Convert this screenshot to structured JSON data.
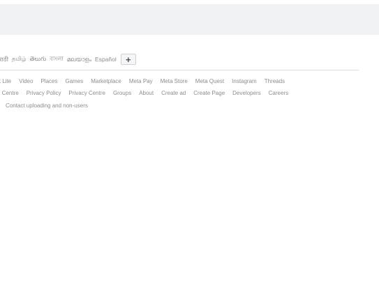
{
  "languages": [
    "मराठी",
    "தமிழ்",
    "తెలుగు",
    "বাংলা",
    "മലയാളം",
    "Español"
  ],
  "add_language_label": "+",
  "footer_links_row1": [
    "k Lite",
    "Video",
    "Places",
    "Games",
    "Marketplace",
    "Meta Pay",
    "Meta Store",
    "Meta Quest",
    "Instagram",
    "Threads"
  ],
  "footer_links_row2": [
    "n Centre",
    "Privacy Policy",
    "Privacy Centre",
    "Groups",
    "About",
    "Create ad",
    "Create Page",
    "Developers",
    "Careers"
  ],
  "footer_links_row3": [
    "Contact uploading and non-users"
  ],
  "colors": {
    "band": "#f0f2f5",
    "text": "#8a8d91",
    "divider": "#dddfe2"
  }
}
